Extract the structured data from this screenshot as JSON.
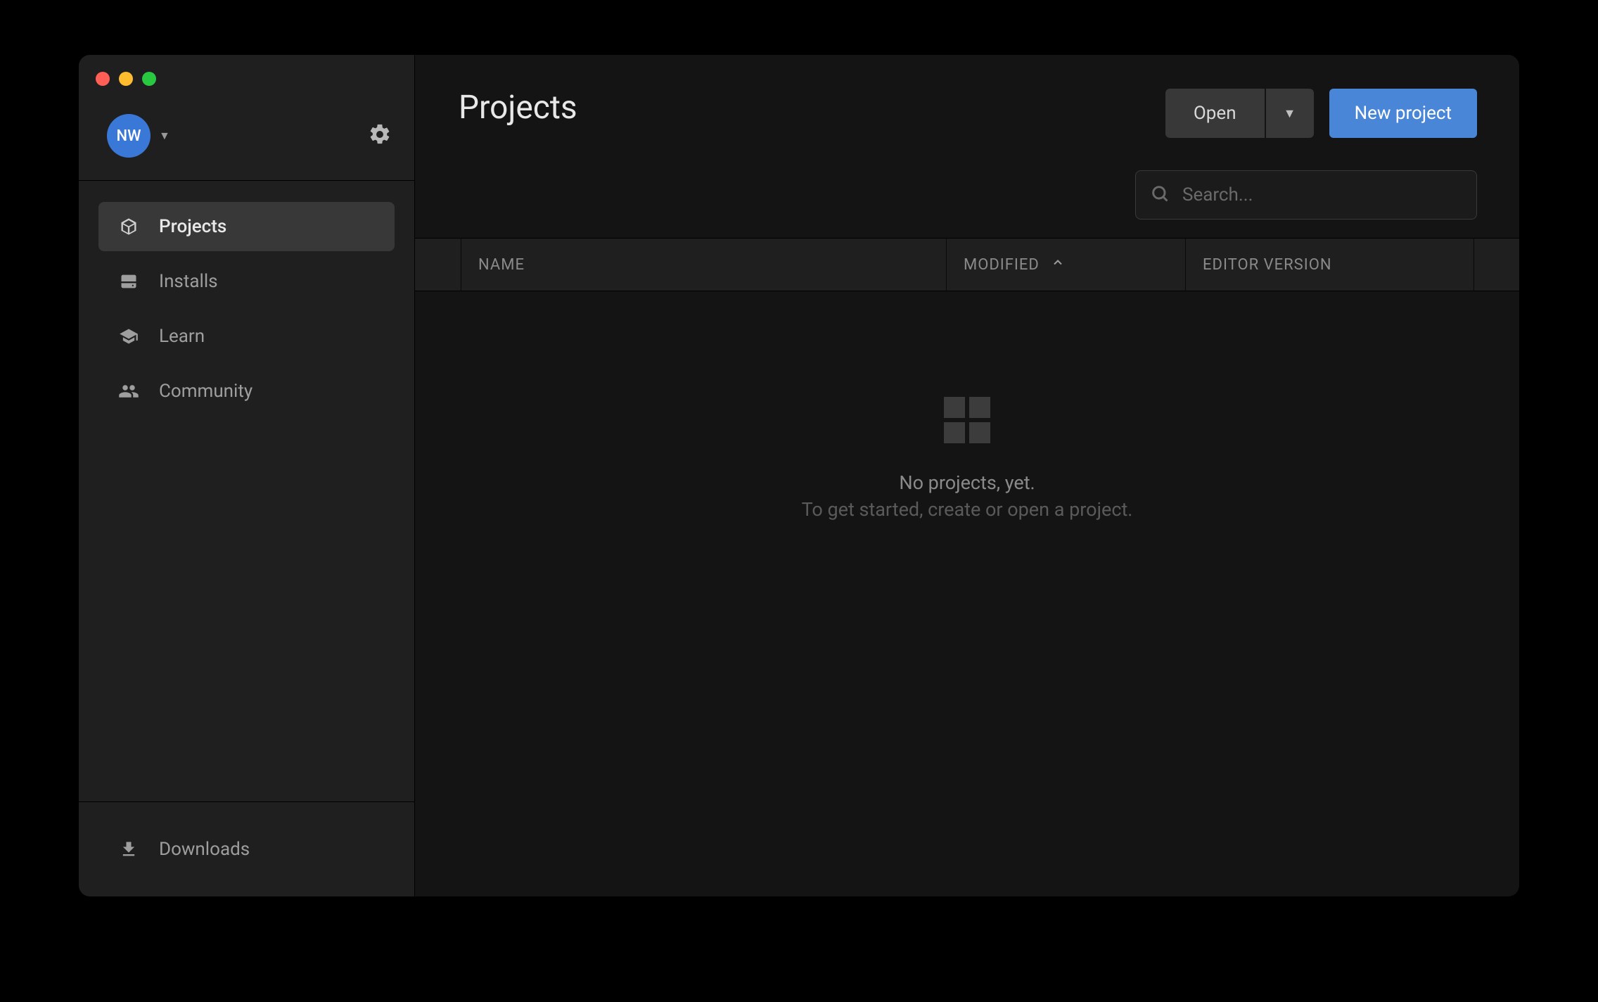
{
  "user": {
    "initials": "NW"
  },
  "sidebar": {
    "items": [
      {
        "label": "Projects"
      },
      {
        "label": "Installs"
      },
      {
        "label": "Learn"
      },
      {
        "label": "Community"
      }
    ],
    "footer": {
      "label": "Downloads"
    }
  },
  "header": {
    "title": "Projects",
    "open_label": "Open",
    "new_project_label": "New project"
  },
  "search": {
    "placeholder": "Search..."
  },
  "table": {
    "columns": {
      "name": "NAME",
      "modified": "MODIFIED",
      "version": "EDITOR VERSION"
    }
  },
  "empty": {
    "title": "No projects, yet.",
    "subtitle": "To get started, create or open a project."
  }
}
